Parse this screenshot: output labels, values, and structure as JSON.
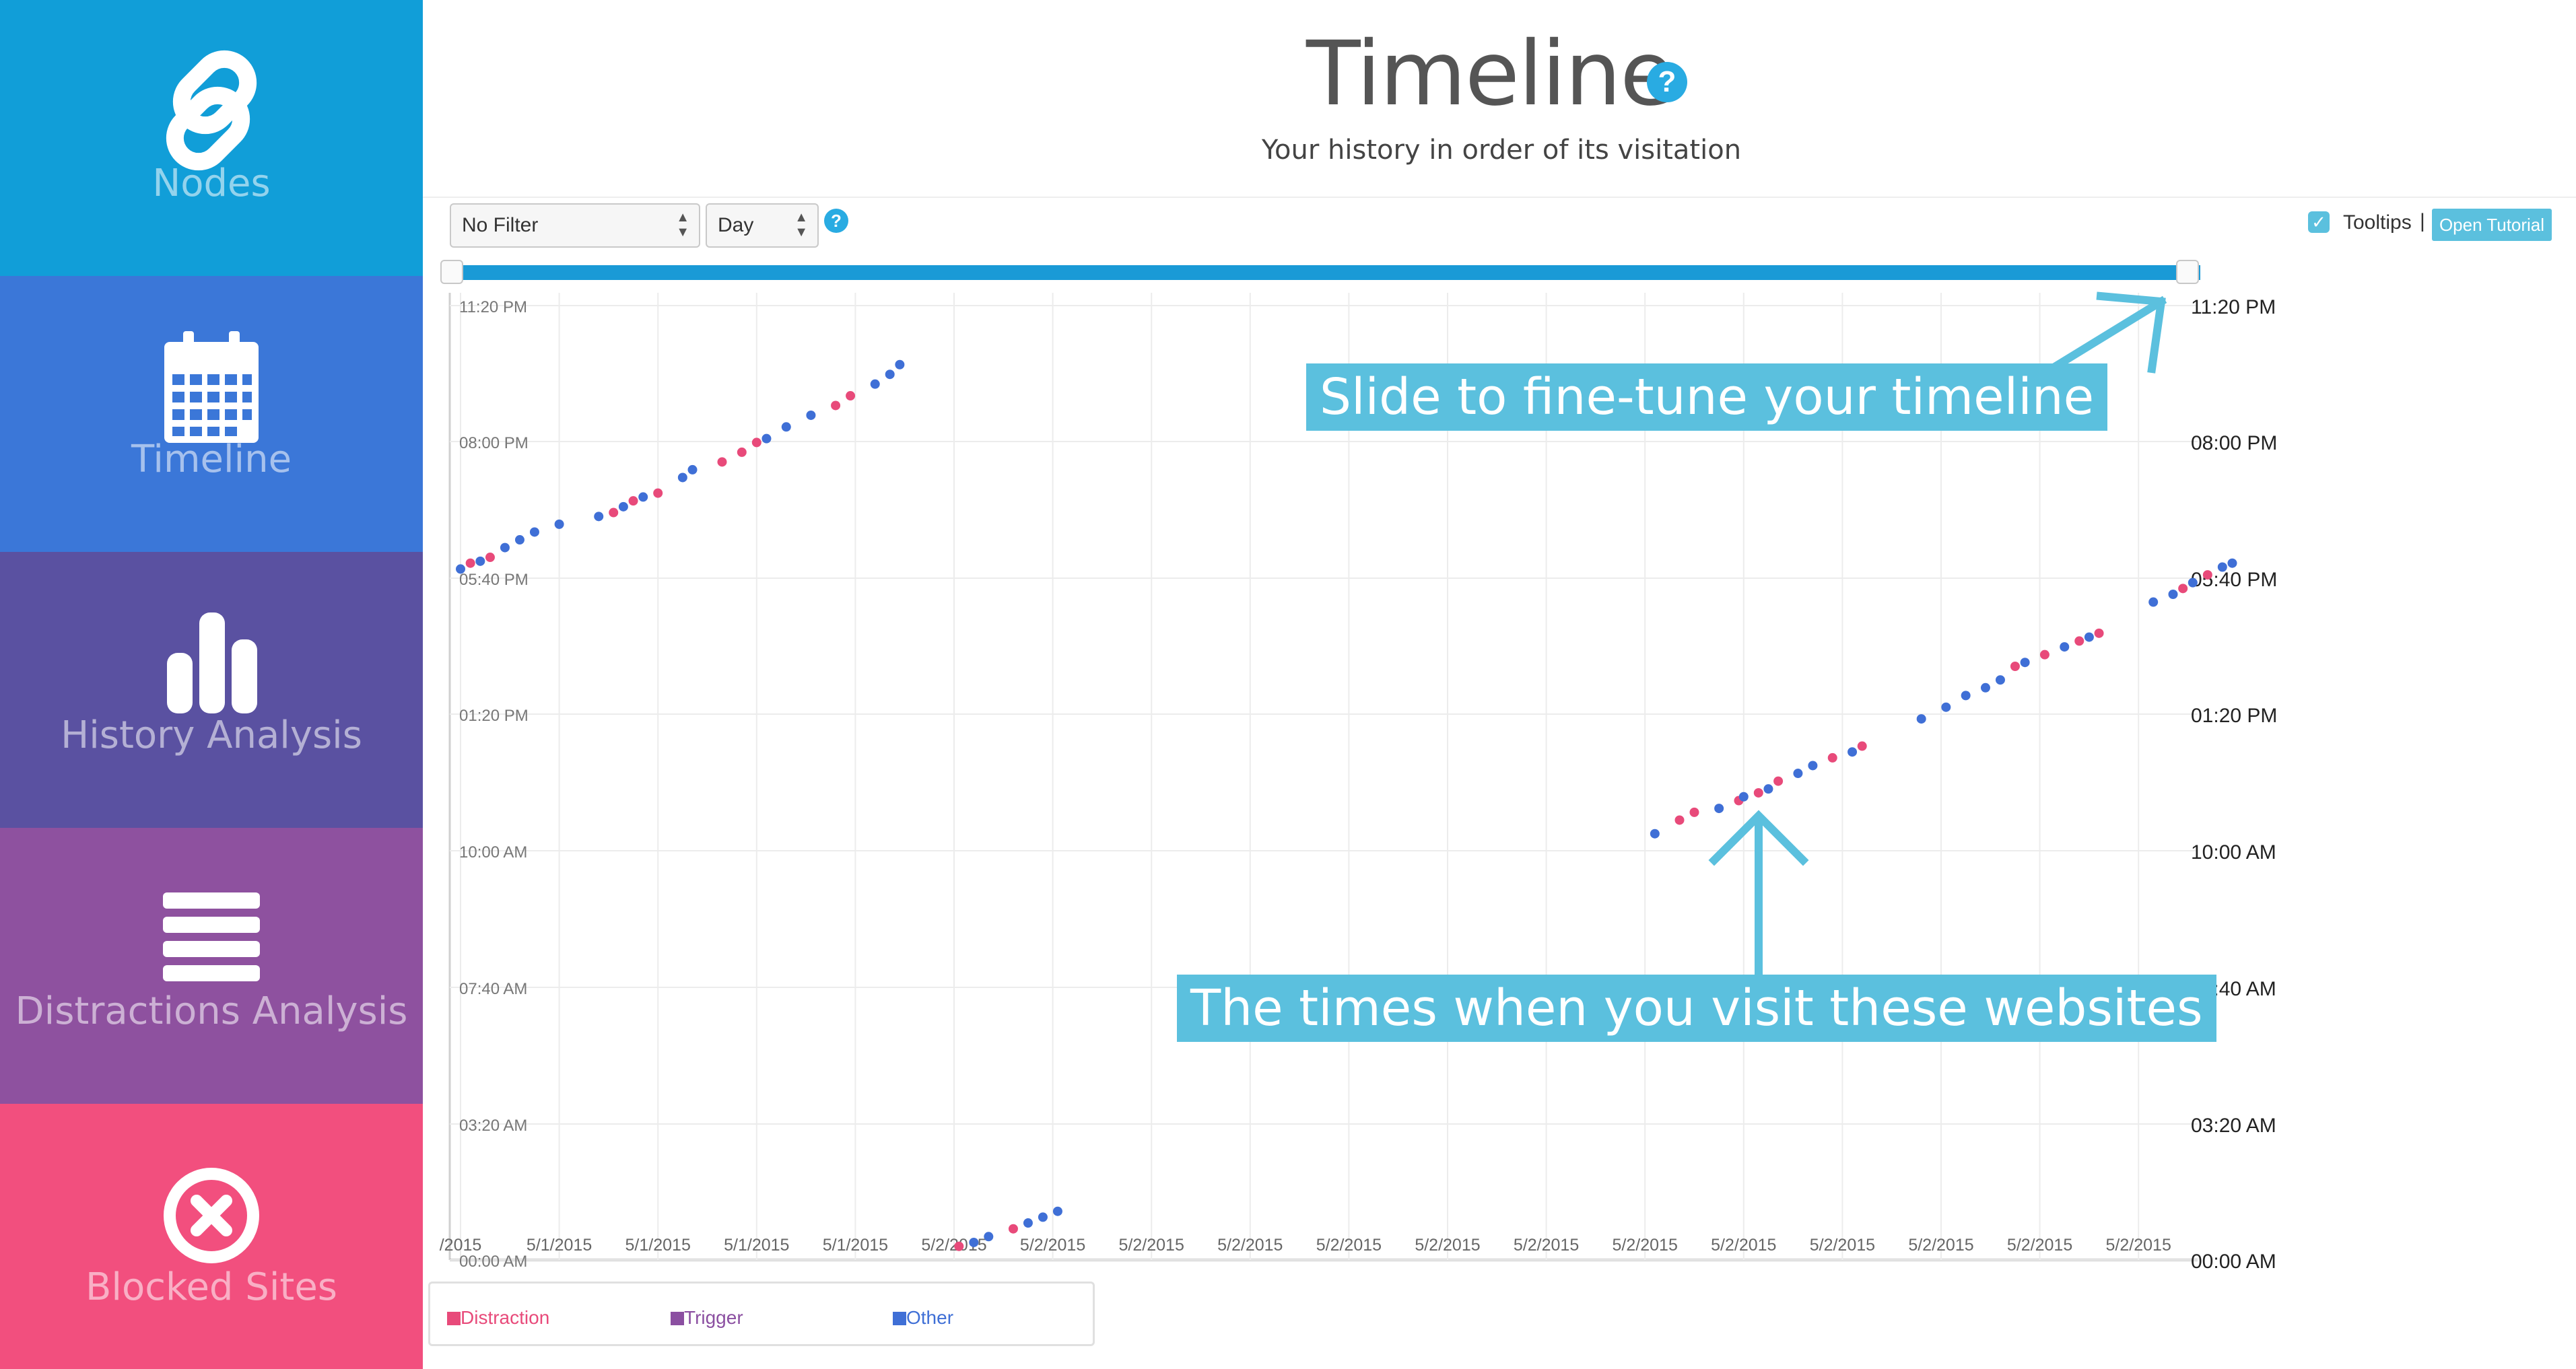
{
  "sidebar": {
    "items": [
      {
        "label": "Nodes",
        "icon": "link-icon",
        "color": "#119ED8"
      },
      {
        "label": "Timeline",
        "icon": "calendar-icon",
        "color": "#3B77D8"
      },
      {
        "label": "History Analysis",
        "icon": "bar-chart-icon",
        "color": "#5A51A1"
      },
      {
        "label": "Distractions Analysis",
        "icon": "list-icon",
        "color": "#8E519F"
      },
      {
        "label": "Blocked Sites",
        "icon": "close-circle-icon",
        "color": "#F24F7E"
      }
    ]
  },
  "header": {
    "title": "Timeline",
    "help_icon": "?",
    "subtitle": "Your history in order of its visitation"
  },
  "controls": {
    "filter_value": "No Filter",
    "period_value": "Day",
    "help_icon": "?",
    "tooltips_label": "Tooltips",
    "tooltips_checked": true,
    "separator": "|",
    "tutorial_button": "Open Tutorial"
  },
  "slider": {
    "range_start": 0.0,
    "range_end": 1.0
  },
  "callouts": {
    "slider": "Slide to fine-tune your timeline",
    "points": "The times when you visit these websites"
  },
  "legend": [
    {
      "label": "Distraction",
      "color": "#E84A7A"
    },
    {
      "label": "Trigger",
      "color": "#8B4FA1"
    },
    {
      "label": "Other",
      "color": "#3F6FD6"
    }
  ],
  "chart_data": {
    "type": "scatter",
    "x_tick_labels": [
      "/2015",
      "5/1/2015",
      "5/1/2015",
      "5/1/2015",
      "5/1/2015",
      "5/2/2015",
      "5/2/2015",
      "5/2/2015",
      "5/2/2015",
      "5/2/2015",
      "5/2/2015",
      "5/2/2015",
      "5/2/2015",
      "5/2/2015",
      "5/2/2015",
      "5/2/2015",
      "5/2/2015",
      "5/2/2015"
    ],
    "y_tick_labels": [
      "00:00 AM",
      "03:20 AM",
      "07:40 AM",
      "10:00 AM",
      "01:20 PM",
      "05:40 PM",
      "08:00 PM",
      "11:20 PM"
    ],
    "grid": true,
    "colors": {
      "distraction": "#E84A7A",
      "other": "#3F6FD6"
    },
    "series": [
      {
        "name": "Distraction",
        "points": [
          [
            0.1,
            17.9
          ],
          [
            0.3,
            18.05
          ],
          [
            1.55,
            19.2
          ],
          [
            1.75,
            19.5
          ],
          [
            2.0,
            19.7
          ],
          [
            2.65,
            20.5
          ],
          [
            2.85,
            20.75
          ],
          [
            3.0,
            21.0
          ],
          [
            3.8,
            21.95
          ],
          [
            3.95,
            22.2
          ],
          [
            5.05,
            0.35
          ],
          [
            5.6,
            0.8
          ],
          [
            12.35,
            11.3
          ],
          [
            12.5,
            11.5
          ],
          [
            12.95,
            11.8
          ],
          [
            13.15,
            12.0
          ],
          [
            13.35,
            12.3
          ],
          [
            13.9,
            12.9
          ],
          [
            14.2,
            13.2
          ],
          [
            15.75,
            15.25
          ],
          [
            16.05,
            15.55
          ],
          [
            16.4,
            15.9
          ],
          [
            16.6,
            16.1
          ],
          [
            17.45,
            17.25
          ],
          [
            17.7,
            17.6
          ]
        ]
      },
      {
        "name": "Other",
        "points": [
          [
            0.0,
            17.75
          ],
          [
            0.2,
            17.95
          ],
          [
            0.45,
            18.3
          ],
          [
            0.6,
            18.5
          ],
          [
            0.75,
            18.7
          ],
          [
            1.0,
            18.9
          ],
          [
            1.4,
            19.1
          ],
          [
            1.65,
            19.35
          ],
          [
            1.85,
            19.6
          ],
          [
            2.25,
            20.1
          ],
          [
            2.35,
            20.3
          ],
          [
            3.1,
            21.1
          ],
          [
            3.3,
            21.4
          ],
          [
            3.55,
            21.7
          ],
          [
            4.2,
            22.5
          ],
          [
            4.35,
            22.75
          ],
          [
            4.45,
            23.0
          ],
          [
            5.2,
            0.45
          ],
          [
            5.35,
            0.6
          ],
          [
            5.75,
            0.95
          ],
          [
            5.9,
            1.1
          ],
          [
            6.05,
            1.25
          ],
          [
            12.1,
            10.95
          ],
          [
            12.75,
            11.6
          ],
          [
            13.0,
            11.9
          ],
          [
            13.25,
            12.1
          ],
          [
            13.55,
            12.5
          ],
          [
            13.7,
            12.7
          ],
          [
            14.1,
            13.05
          ],
          [
            14.8,
            13.9
          ],
          [
            15.05,
            14.2
          ],
          [
            15.25,
            14.5
          ],
          [
            15.45,
            14.7
          ],
          [
            15.6,
            14.9
          ],
          [
            15.85,
            15.35
          ],
          [
            16.25,
            15.75
          ],
          [
            16.5,
            16.0
          ],
          [
            17.15,
            16.9
          ],
          [
            17.35,
            17.1
          ],
          [
            17.55,
            17.4
          ],
          [
            17.85,
            17.8
          ],
          [
            17.95,
            17.9
          ]
        ]
      }
    ]
  }
}
